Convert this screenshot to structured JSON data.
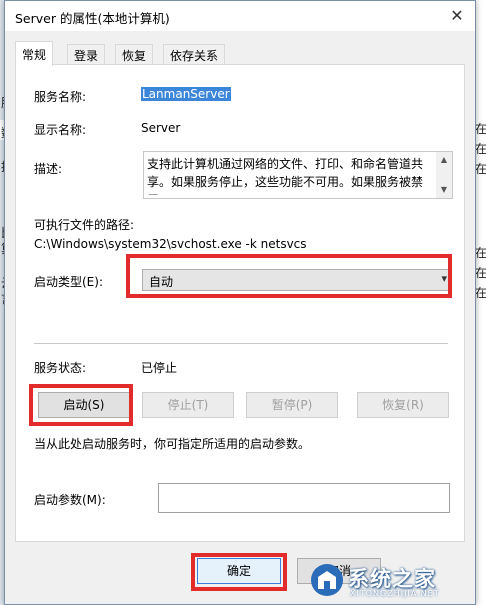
{
  "window": {
    "title": "Server 的属性(本地计算机)",
    "close_glyph": "✕"
  },
  "tabs": [
    {
      "label": "常规",
      "active": true
    },
    {
      "label": "登录",
      "active": false
    },
    {
      "label": "恢复",
      "active": false
    },
    {
      "label": "依存关系",
      "active": false
    }
  ],
  "general": {
    "service_name_label": "服务名称:",
    "service_name_value": "LanmanServer",
    "display_name_label": "显示名称:",
    "display_name_value": "Server",
    "description_label": "描述:",
    "description_value": "支持此计算机通过网络的文件、打印、和命名管道共享。如果服务停止，这些功能不可用。如果服务被禁用，",
    "exec_path_label": "可执行文件的路径:",
    "exec_path_value": "C:\\Windows\\system32\\svchost.exe -k netsvcs",
    "startup_type_label": "启动类型(E):",
    "startup_type_value": "自动",
    "service_status_label": "服务状态:",
    "service_status_value": "已停止",
    "buttons": {
      "start": "启动(S)",
      "stop": "停止(T)",
      "pause": "暂停(P)",
      "resume": "恢复(R)"
    },
    "hint": "当从此处启动服务时，你可指定所适用的启动参数。",
    "start_params_label": "启动参数(M):",
    "start_params_value": ""
  },
  "footer": {
    "ok": "确定",
    "cancel": "取消"
  },
  "watermark": {
    "text": "系统之家",
    "sub": "XITONGZHIJIA.NET"
  },
  "background_window": {
    "left_glyphs": [
      "服",
      "数",
      "描",
      "比",
      "算",
      "云",
      "言"
    ],
    "right_glyphs": [
      "在",
      "在",
      "在",
      "在",
      "在",
      "在"
    ]
  },
  "colors": {
    "highlight": "#e22c2c",
    "selection": "#3b86d8",
    "accent": "#3b7bd9"
  }
}
